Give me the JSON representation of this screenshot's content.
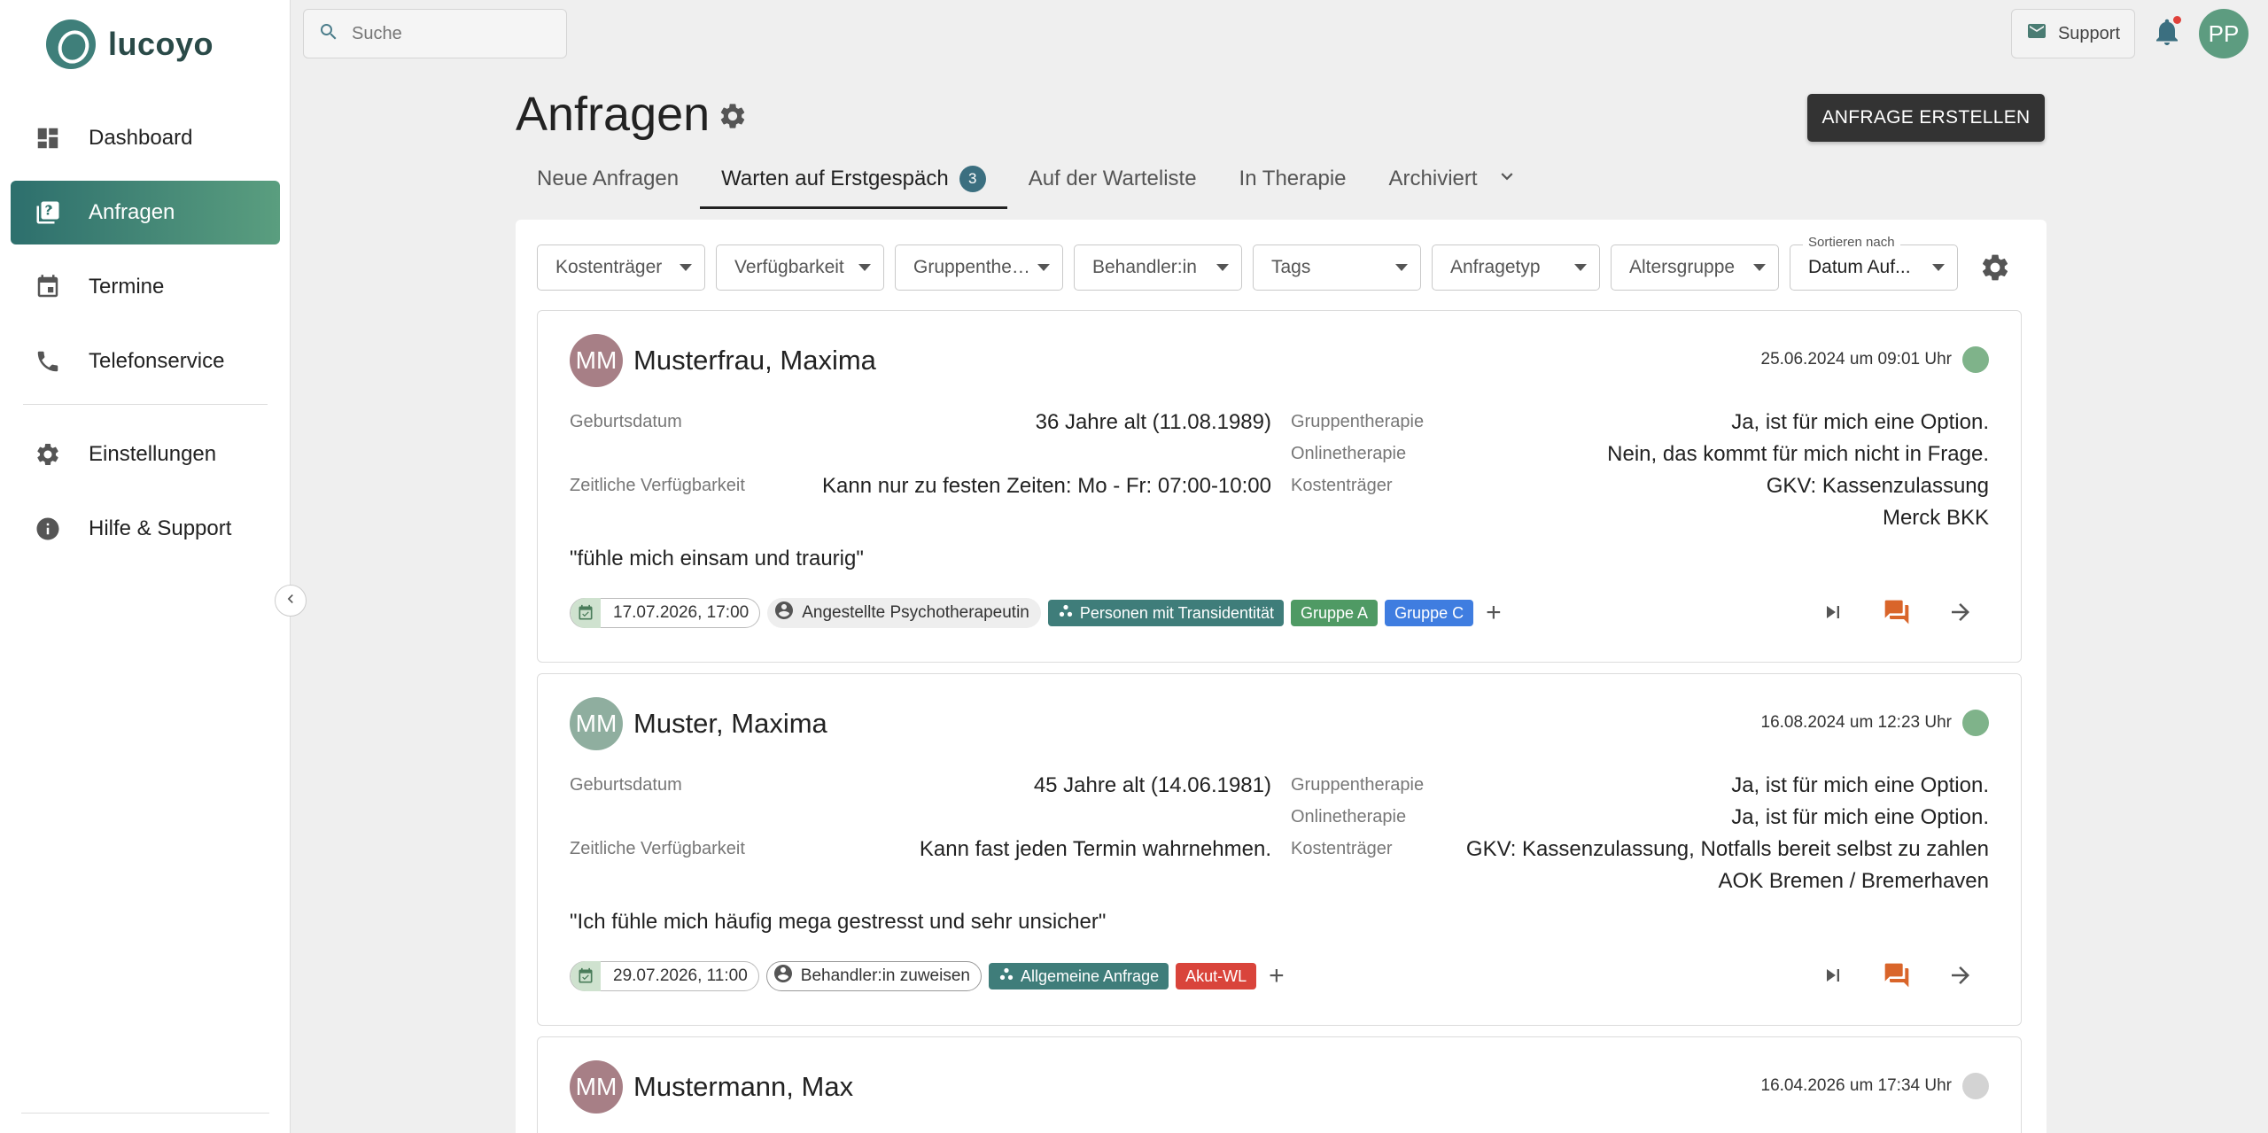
{
  "app": {
    "name": "lucoyo"
  },
  "sidebar": {
    "items": [
      {
        "label": "Dashboard",
        "icon": "dashboard-icon"
      },
      {
        "label": "Anfragen",
        "icon": "requests-icon",
        "active": true
      },
      {
        "label": "Termine",
        "icon": "calendar-icon"
      },
      {
        "label": "Telefonservice",
        "icon": "phone-icon"
      }
    ],
    "items_bottom": [
      {
        "label": "Einstellungen",
        "icon": "gear-icon"
      },
      {
        "label": "Hilfe & Support",
        "icon": "info-icon"
      }
    ]
  },
  "topbar": {
    "search_placeholder": "Suche",
    "support_label": "Support",
    "user_initials": "PP"
  },
  "page": {
    "title": "Anfragen",
    "create_button": "ANFRAGE ERSTELLEN",
    "tabs": [
      {
        "label": "Neue Anfragen"
      },
      {
        "label": "Warten auf Erstgespäch",
        "badge": "3",
        "active": true
      },
      {
        "label": "Auf der Warteliste"
      },
      {
        "label": "In Therapie"
      },
      {
        "label": "Archiviert"
      }
    ]
  },
  "filters": {
    "items": [
      "Kostenträger",
      "Verfügbarkeit",
      "Gruppentherap...",
      "Behandler:in",
      "Tags",
      "Anfragetyp",
      "Altersgruppe"
    ],
    "sort_label": "Sortieren nach",
    "sort_value": "Datum Auf..."
  },
  "labels": {
    "birthdate": "Geburtsdatum",
    "availability": "Zeitliche Verfügbarkeit",
    "group_therapy": "Gruppentherapie",
    "online_therapy": "Onlinetherapie",
    "payer": "Kostenträger"
  },
  "requests": [
    {
      "initials": "MM",
      "name": "Musterfrau, Maxima",
      "datetime": "25.06.2024 um 09:01 Uhr",
      "avatar_color": "#a77f86",
      "status_color": "#7fb38a",
      "birthdate": "36 Jahre alt (11.08.1989)",
      "availability": "Kann nur zu festen Zeiten: Mo - Fr: 07:00-10:00",
      "group_therapy": "Ja, ist für mich eine Option.",
      "online_therapy": "Nein, das kommt für mich nicht in Frage.",
      "payer": "GKV: Kassenzulassung",
      "insurer": "Merck BKK",
      "quote": "\"fühle mich einsam und traurig\"",
      "appointment": "17.07.2026, 17:00",
      "therapist": "Angestellte Psychotherapeutin",
      "request_type": "Personen mit Transidentität",
      "tags": [
        {
          "label": "Gruppe A",
          "color": "#4f9a64"
        },
        {
          "label": "Gruppe C",
          "color": "#3f7de0"
        }
      ]
    },
    {
      "initials": "MM",
      "name": "Muster, Maxima",
      "datetime": "16.08.2024 um 12:23 Uhr",
      "avatar_color": "#8fae9f",
      "status_color": "#7fb38a",
      "birthdate": "45 Jahre alt (14.06.1981)",
      "availability": "Kann fast jeden Termin wahrnehmen.",
      "group_therapy": "Ja, ist für mich eine Option.",
      "online_therapy": "Ja, ist für mich eine Option.",
      "payer": "GKV: Kassenzulassung, Notfalls bereit selbst zu zahlen",
      "insurer": "AOK Bremen / Bremerhaven",
      "quote": "\"Ich fühle mich häufig mega gestresst und sehr unsicher\"",
      "appointment": "29.07.2026, 11:00",
      "therapist": "Behandler:in zuweisen",
      "request_type": "Allgemeine Anfrage",
      "tags": [
        {
          "label": "Akut-WL",
          "color": "#d9443b"
        }
      ]
    },
    {
      "initials": "MM",
      "name": "Mustermann, Max",
      "datetime": "16.04.2026 um 17:34 Uhr",
      "avatar_color": "#a77f86",
      "status_color": "#d3d3d3"
    }
  ]
}
